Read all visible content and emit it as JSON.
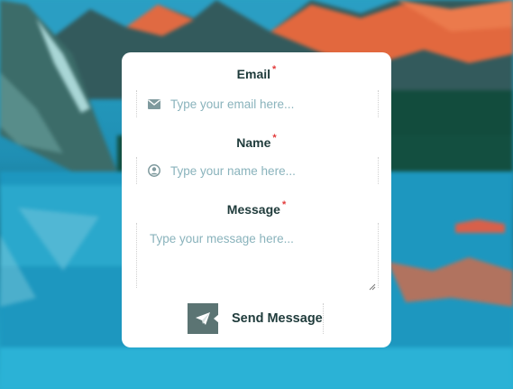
{
  "form": {
    "email": {
      "label": "Email",
      "required_mark": "*",
      "placeholder": "Type your email here..."
    },
    "name": {
      "label": "Name",
      "required_mark": "*",
      "placeholder": "Type your name here..."
    },
    "message": {
      "label": "Message",
      "required_mark": "*",
      "placeholder": "Type your message here..."
    },
    "submit_label": "Send Message"
  },
  "colors": {
    "label_text": "#1f3b3b",
    "required_mark": "#e23b3b",
    "placeholder_text": "#8ab3bc",
    "button_icon_bg": "#5b7473",
    "card_bg": "#ffffff"
  },
  "icons": {
    "email": "envelope-icon",
    "name": "user-circle-icon",
    "submit": "paper-plane-icon",
    "textarea_resize": "resize-grip-icon"
  }
}
